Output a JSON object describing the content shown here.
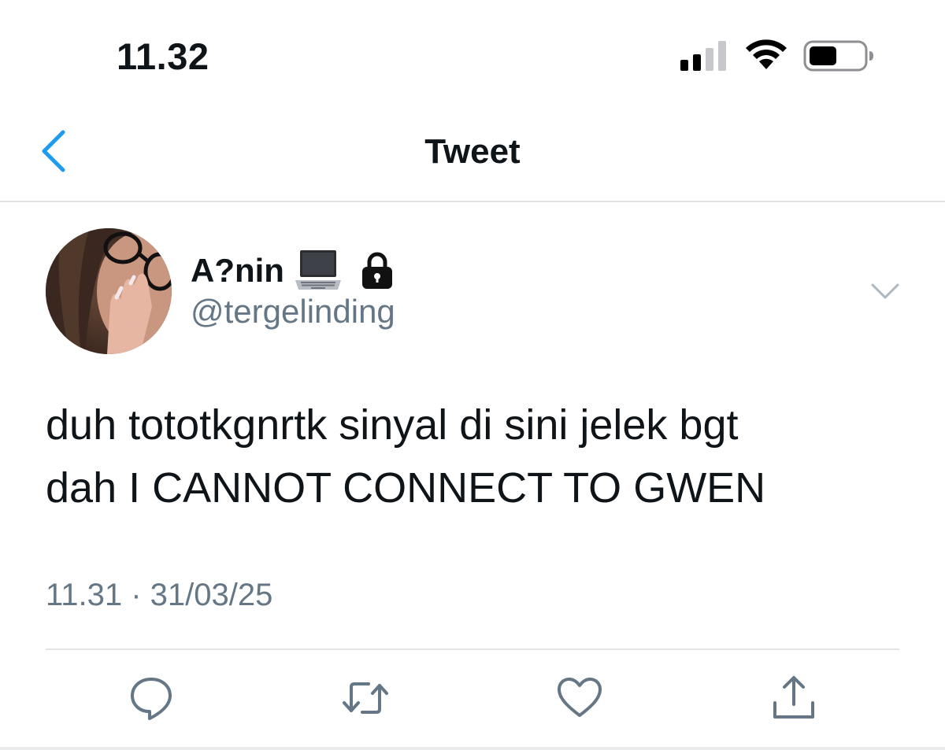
{
  "status_bar": {
    "time": "11.32",
    "signal_icon": "cellular-signal-icon",
    "wifi_icon": "wifi-icon",
    "battery_icon": "battery-icon",
    "battery_level": 0.5
  },
  "nav": {
    "title": "Tweet",
    "back_icon": "chevron-left-icon"
  },
  "tweet": {
    "author": {
      "display_name": "A?nin",
      "display_name_emoji": [
        "laptop-icon",
        "lock-icon"
      ],
      "handle": "@tergelinding"
    },
    "text_line1": "duh tototkgnrtk sinyal di sini jelek bgt",
    "text_line2": "dah I CANNOT CONNECT TO GWEN",
    "timestamp": "11.31 · 31/03/25",
    "menu_icon": "chevron-down-icon"
  },
  "actions": [
    {
      "name": "reply",
      "icon": "reply-icon"
    },
    {
      "name": "retweet",
      "icon": "retweet-icon"
    },
    {
      "name": "like",
      "icon": "heart-icon"
    },
    {
      "name": "share",
      "icon": "share-icon"
    }
  ],
  "colors": {
    "accent": "#1d9bf0",
    "text_primary": "#0f1419",
    "text_secondary": "#657786",
    "icon_gray": "#657786",
    "divider": "#e1e3e5"
  }
}
